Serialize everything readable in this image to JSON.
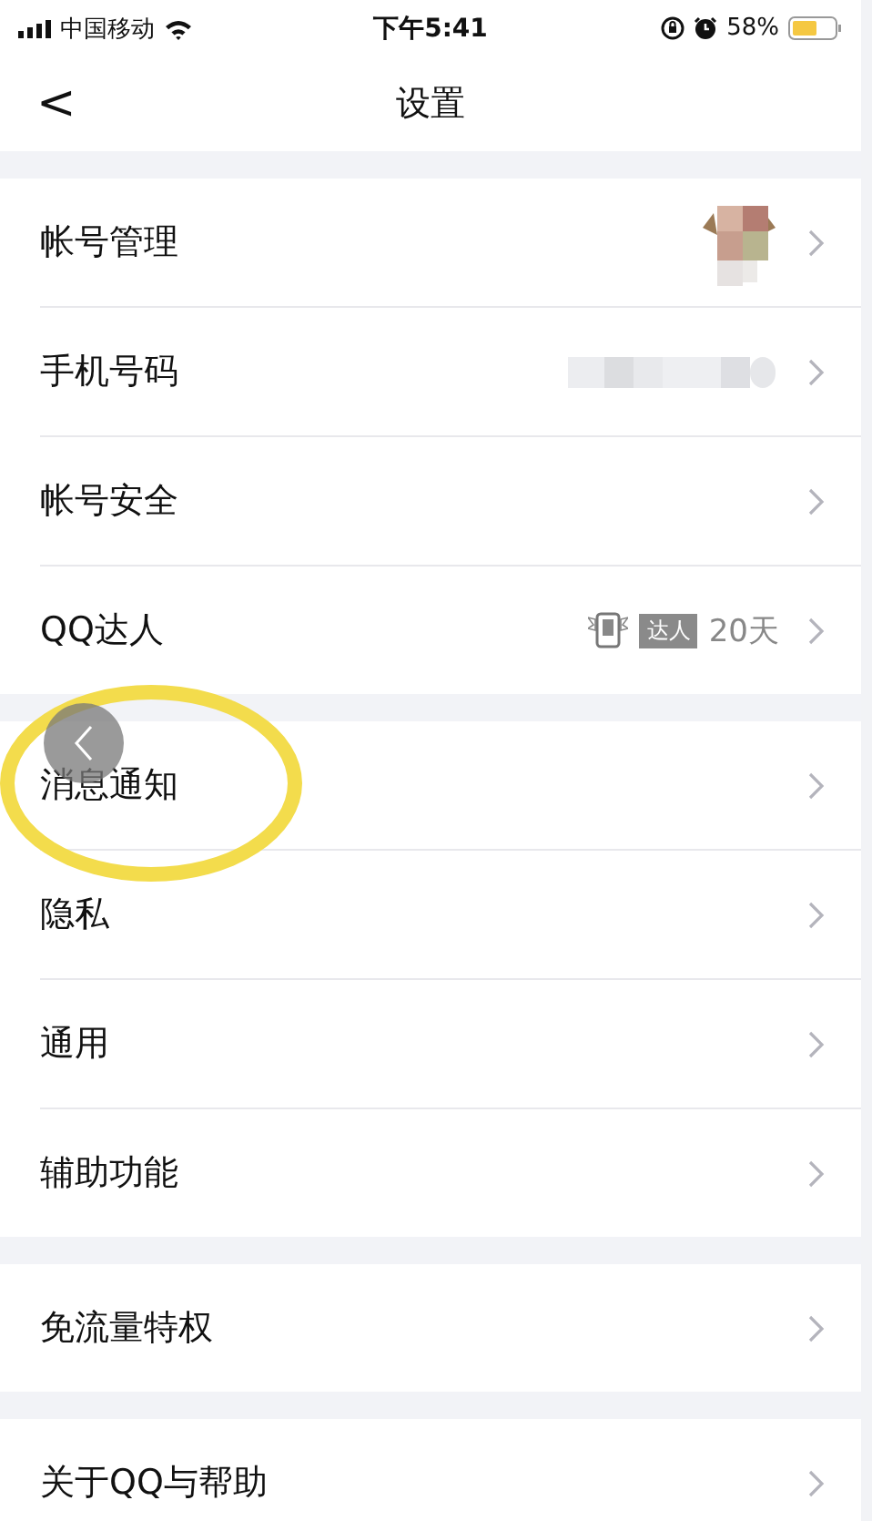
{
  "status_bar": {
    "carrier": "中国移动",
    "time": "下午5:41",
    "battery": "58%"
  },
  "nav": {
    "back": "<",
    "title": "设置"
  },
  "groups": [
    {
      "rows": [
        {
          "kind": "avatar",
          "label": "帐号管理",
          "circled": false
        },
        {
          "kind": "masked",
          "label": "手机号码",
          "circled": false
        },
        {
          "kind": "plain",
          "label": "帐号安全",
          "circled": false
        },
        {
          "kind": "badge",
          "label": "QQ达人",
          "badge": "达人",
          "value": "20天",
          "circled": false
        }
      ]
    },
    {
      "rows": [
        {
          "kind": "plain",
          "label": "消息通知",
          "circled": true
        },
        {
          "kind": "plain",
          "label": "隐私",
          "circled": false
        },
        {
          "kind": "plain",
          "label": "通用",
          "circled": false
        },
        {
          "kind": "plain",
          "label": "辅助功能",
          "circled": false
        }
      ]
    },
    {
      "rows": [
        {
          "kind": "plain",
          "label": "免流量特权",
          "circled": false
        }
      ]
    },
    {
      "rows": [
        {
          "kind": "plain",
          "label": "关于QQ与帮助",
          "circled": false
        }
      ]
    }
  ],
  "floating_back": {
    "shown": true
  }
}
